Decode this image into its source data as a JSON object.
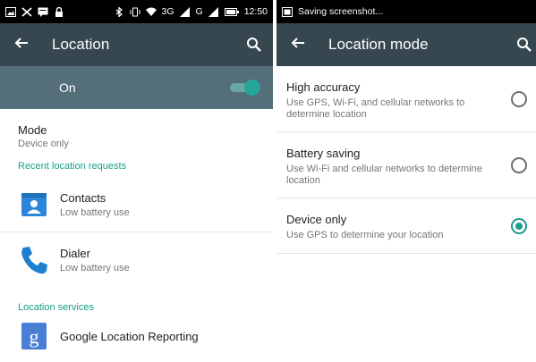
{
  "left": {
    "status_bar": {
      "icons": [
        "gallery-icon",
        "no-sim-icon",
        "chat-icon",
        "lock-icon",
        "bluetooth-icon",
        "vibrate-icon",
        "wifi-icon",
        "signal-icon",
        "battery-icon"
      ],
      "network_1": "3G",
      "network_2": "G",
      "time": "12:50"
    },
    "app_bar": {
      "title": "Location",
      "back_icon": "back-arrow-icon",
      "search_icon": "search-icon"
    },
    "master_toggle": {
      "label": "On",
      "state": "on"
    },
    "mode": {
      "label": "Mode",
      "value": "Device only"
    },
    "recent_header": "Recent location requests",
    "recent_requests": [
      {
        "name": "Contacts",
        "battery": "Low battery use",
        "icon": "contacts-app-icon"
      },
      {
        "name": "Dialer",
        "battery": "Low battery use",
        "icon": "phone-app-icon"
      }
    ],
    "services_header": "Location services",
    "services": [
      {
        "name": "Google Location Reporting",
        "icon": "google-settings-icon"
      }
    ]
  },
  "right": {
    "status_bar": {
      "notification_icon": "screenshot-icon",
      "text": "Saving screenshot..."
    },
    "app_bar": {
      "title": "Location mode",
      "back_icon": "back-arrow-icon",
      "search_icon": "search-icon"
    },
    "options": [
      {
        "title": "High accuracy",
        "description": "Use GPS, Wi-Fi, and cellular networks to determine location",
        "selected": false
      },
      {
        "title": "Battery saving",
        "description": "Use Wi-Fi and cellular networks to determine location",
        "selected": false
      },
      {
        "title": "Device only",
        "description": "Use GPS to determine your location",
        "selected": true
      }
    ]
  },
  "colors": {
    "app_bar": "#37474f",
    "toggle_bar": "#546e7a",
    "accent": "#16a085",
    "radio_selected": "#1e9b8a"
  }
}
